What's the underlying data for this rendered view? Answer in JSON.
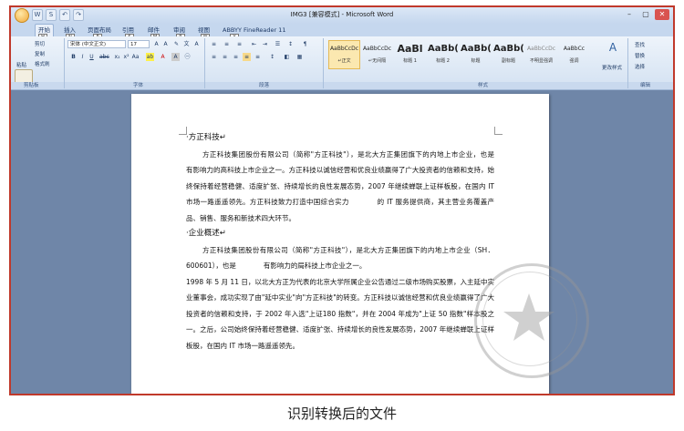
{
  "window": {
    "title": "IMG3 [兼容模式] - Microsoft Word",
    "qat": [
      "W",
      "S",
      "↶",
      "↷"
    ]
  },
  "tabs": [
    {
      "label": "开始",
      "keytip": "H"
    },
    {
      "label": "插入",
      "keytip": "N"
    },
    {
      "label": "页面布局",
      "keytip": "P"
    },
    {
      "label": "引用",
      "keytip": "S"
    },
    {
      "label": "邮件",
      "keytip": "M"
    },
    {
      "label": "审阅",
      "keytip": "R"
    },
    {
      "label": "视图",
      "keytip": "W"
    },
    {
      "label": "ABBYY FineReader 11",
      "keytip": "Y"
    }
  ],
  "ribbon": {
    "clipboard": {
      "paste": "粘贴",
      "cut": "剪切",
      "copy": "复制",
      "format_painter": "格式刷",
      "label": "剪贴板"
    },
    "font": {
      "font_name": "宋体 (中文正文)",
      "font_size": "17",
      "label": "字体"
    },
    "paragraph": {
      "label": "段落"
    },
    "styles": {
      "label": "样式",
      "items": [
        {
          "sample": "AaBbCcDc",
          "name": "↵正文"
        },
        {
          "sample": "AaBbCcDc",
          "name": "↵无间隔"
        },
        {
          "sample": "AaBl",
          "name": "标题 1"
        },
        {
          "sample": "AaBb(",
          "name": "标题 2"
        },
        {
          "sample": "AaBb(",
          "name": "标题"
        },
        {
          "sample": "AaBb(",
          "name": "副标题"
        },
        {
          "sample": "AaBbCcDc",
          "name": "不明显强调"
        },
        {
          "sample": "AaBbCc",
          "name": "强调"
        }
      ],
      "change_styles": "更改样式"
    },
    "editing": {
      "find": "查找",
      "replace": "替换",
      "select": "选择",
      "label": "编辑"
    }
  },
  "document": {
    "heading1": "方正科技",
    "para1": "方正科技集团股份有限公司（简称\"方正科技\"），是北大方正集团旗下的内地上市企业，也是　　　　有影响力的高科技上市企业之一。方正科技以诚信经营和优良业绩赢得了广大投资者的信赖和支持，始终保持着经营稳健、适度扩张、持续增长的良性发展态势，2007 年继续蝉联上证样板股，在国内 IT 市场一路遥遥领先。方正科技致力打造中国综合实力　　　　的 IT 服务提供商，其主营业务覆盖产品、销售、服务和新技术四大环节。",
    "heading2": "企业概述",
    "para2": "方正科技集团股份有限公司（简称\"方正科技\"），是北大方正集团旗下的内地上市企业（SH．600601），也是　　　　有影响力的局科技上市企业之一。",
    "para3": "1998 年 5 月 11 日，以北大方正为代表的北京大学所属企业公告通过二级市场购买股票，入主延中实业董事会，成功实现了由\"延中实业\"向\"方正科技\"的转变。方正科技以诚信经营和优良业绩赢得了广大投资者的信赖和支持，于 2002 年入选\"上证180 指数\"，并在 2004 年成为\"上证 50 指数\"样本股之一。之后，公司始终保持着经营稳健、适度扩张、持续增长的良性发展态势，2007 年继续蝉联上证样板股，在国内 IT 市场一路遥遥领先。"
  },
  "caption": "识别转换后的文件"
}
